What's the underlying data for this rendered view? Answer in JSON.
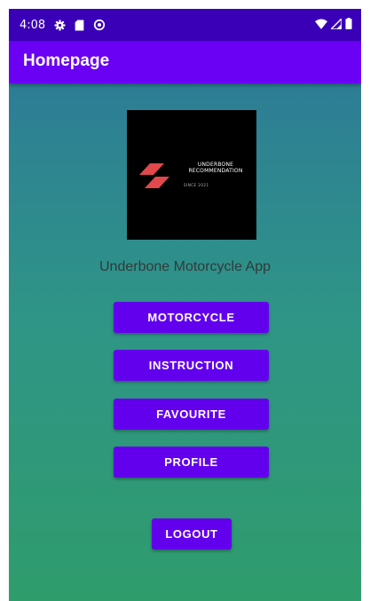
{
  "status_bar": {
    "time": "4:08",
    "left_icons": [
      "settings-gear-icon",
      "sd-card-icon",
      "data-saver-icon"
    ],
    "right_icons": [
      "wifi-icon",
      "cellular-signal-icon",
      "battery-icon"
    ]
  },
  "app_bar": {
    "title": "Homepage"
  },
  "logo": {
    "line1": "UNDERBONE",
    "line2": "RECOMMENDATION",
    "since": "SINCE 2021",
    "mark_color": "#e0484c"
  },
  "app_name": "Underbone Motorcycle App",
  "buttons": {
    "motorcycle": "MOTORCYCLE",
    "instruction": "INSTRUCTION",
    "favourite": "FAVOURITE",
    "profile": "PROFILE",
    "logout": "LOGOUT"
  },
  "colors": {
    "status_bar": "#3a00b8",
    "app_bar": "#6a00f4",
    "button": "#6200ee",
    "gradient_top": "#2d7d95",
    "gradient_bottom": "#2f9c6c"
  }
}
